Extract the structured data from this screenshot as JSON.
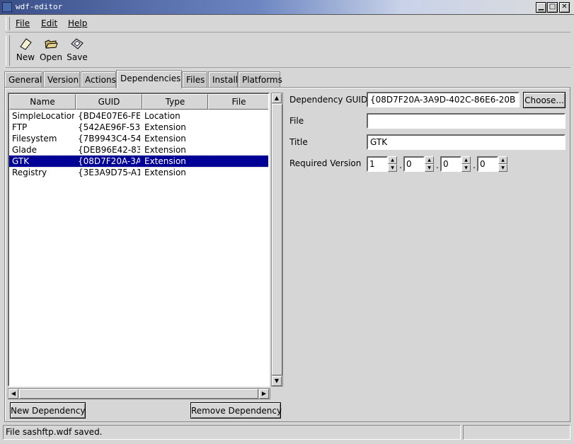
{
  "window": {
    "title": "wdf-editor",
    "controls": {
      "minimize": "▁",
      "maximize": "□",
      "close": "✕"
    }
  },
  "menu": {
    "file": "File",
    "edit": "Edit",
    "help": "Help"
  },
  "toolbar": {
    "new": "New",
    "open": "Open",
    "save": "Save"
  },
  "tabs": [
    {
      "label": "General"
    },
    {
      "label": "Version"
    },
    {
      "label": "Actions"
    },
    {
      "label": "Dependencies"
    },
    {
      "label": "Files"
    },
    {
      "label": "Install"
    },
    {
      "label": "Platforms"
    }
  ],
  "active_tab": "Dependencies",
  "list": {
    "columns": {
      "name": "Name",
      "guid": "GUID",
      "type": "Type",
      "file": "File"
    },
    "rows": [
      {
        "name": "SimpleLocation",
        "guid": "{BD4E07E6-FE",
        "type": "Location",
        "file": ""
      },
      {
        "name": "FTP",
        "guid": "{542AE96F-53",
        "type": "Extension",
        "file": ""
      },
      {
        "name": "Filesystem",
        "guid": "{7B9943C4-54",
        "type": "Extension",
        "file": ""
      },
      {
        "name": "Glade",
        "guid": "{DEB96E42-83",
        "type": "Extension",
        "file": ""
      },
      {
        "name": "GTK",
        "guid": "{08D7F20A-3A",
        "type": "Extension",
        "file": ""
      },
      {
        "name": "Registry",
        "guid": "{3E3A9D75-A1",
        "type": "Extension",
        "file": ""
      }
    ],
    "selected_index": 4
  },
  "buttons": {
    "new_dependency": "New Dependency",
    "remove_dependency": "Remove Dependency",
    "choose": "Choose..."
  },
  "form": {
    "guid_label": "Dependency GUID",
    "guid_value": "{08D7F20A-3A9D-402C-86E6-20B",
    "file_label": "File",
    "file_value": "",
    "title_label": "Title",
    "title_value": "GTK",
    "version_label": "Required Version",
    "version": [
      "1",
      "0",
      "0",
      "0"
    ],
    "version_separator": "."
  },
  "status": {
    "message": "File sashftp.wdf saved."
  },
  "scroll": {
    "up": "▲",
    "down": "▼",
    "left": "◀",
    "right": "▶"
  }
}
